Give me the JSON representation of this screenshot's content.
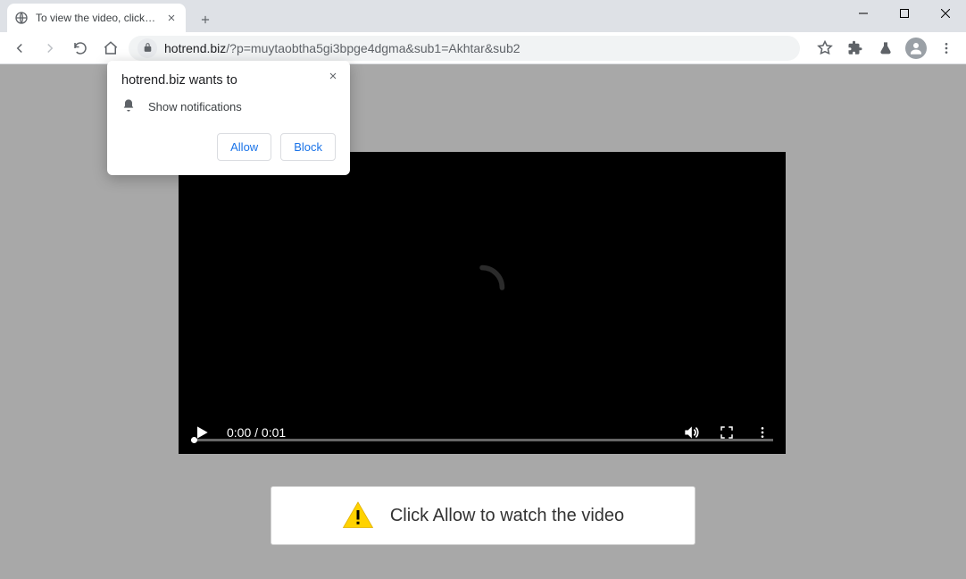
{
  "tab": {
    "title": "To view the video, click the Allow"
  },
  "url": {
    "host": "hotrend.biz",
    "path": "/?p=muytaobtha5gi3bpge4dgma&sub1=Akhtar&sub2"
  },
  "video": {
    "time": "0:00 / 0:01"
  },
  "message": {
    "text": "Click Allow to watch the video"
  },
  "prompt": {
    "title": "hotrend.biz wants to",
    "permission": "Show notifications",
    "allow": "Allow",
    "block": "Block"
  }
}
